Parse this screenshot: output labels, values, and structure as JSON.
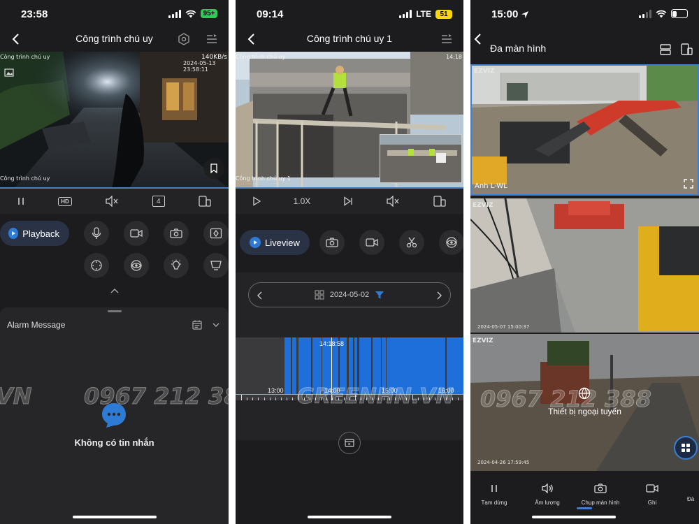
{
  "screens": {
    "live": {
      "time": "23:58",
      "battery": "95+",
      "title": "Công trình chú uy",
      "video": {
        "camera_name_top": "Công trình chú uy",
        "timestamp": "2024-05-13 23:58:11",
        "bitrate": "140KB/s",
        "camera_name_bottom": "Công trình chú uy"
      },
      "controls": {
        "quality": "HD",
        "split_count": "4"
      },
      "playback_label": "Playback",
      "alarm": {
        "title": "Alarm Message",
        "empty_text": "Không có tin nhắn"
      }
    },
    "playback": {
      "time": "09:14",
      "network": "LTE",
      "battery": "51",
      "title": "Công trình chú uy 1",
      "video": {
        "camera_name_top": "Công trình chú uy",
        "time_right": "14:18",
        "camera_name_bottom": "Công trình chú uy 1"
      },
      "speed": "1.0X",
      "liveview_label": "Liveview",
      "date": "2024-05-02",
      "timeline": {
        "cursor_time": "14:18:58",
        "labels": [
          "13:00",
          "14:00",
          "15:00",
          "16:00"
        ]
      }
    },
    "multi": {
      "time": "15:00",
      "title": "Đa màn hình",
      "cams": [
        {
          "name": "Anh L-WL",
          "brand": "EZVIZ"
        },
        {
          "timestamp": "2024-05-07 15:00:37",
          "brand": "EZVIZ"
        },
        {
          "brand": "EZVIZ",
          "offline_text": "Thiết bị ngoại tuyến",
          "timestamp": "2024-04-26 17:59:45"
        }
      ],
      "bottom_bar": [
        "Tạm dừng",
        "Âm lượng",
        "Chụp màn hình",
        "Ghi",
        "Đà"
      ]
    }
  },
  "watermark": {
    "phone": "0967 212 388",
    "site": "GREENHN.VN",
    "site_left": "VN"
  },
  "colors": {
    "accent": "#2e7bd6",
    "bg": "#1c1c1e",
    "timeline_blue": "#1e6fd9"
  }
}
